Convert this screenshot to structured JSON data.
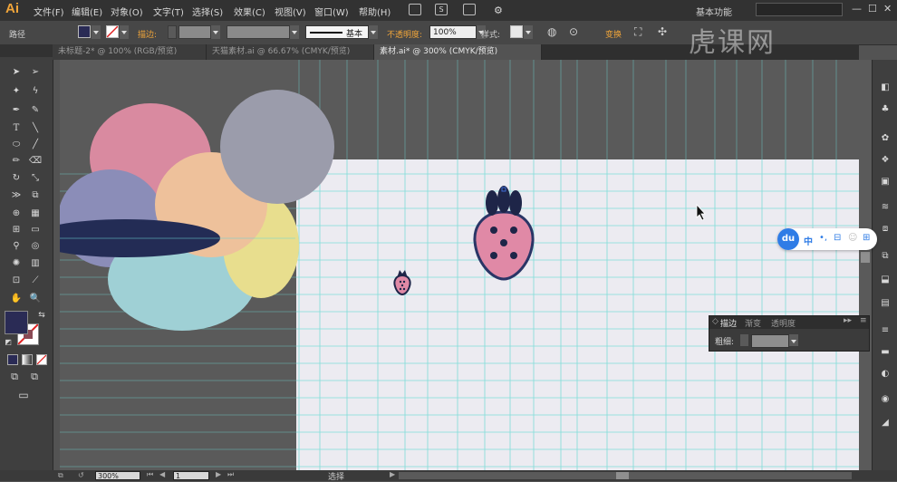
{
  "app": {
    "logo": "Ai"
  },
  "menu": [
    "文件(F)",
    "编辑(E)",
    "对象(O)",
    "文字(T)",
    "选择(S)",
    "效果(C)",
    "视图(V)",
    "窗口(W)",
    "帮助(H)"
  ],
  "menubar_icons": [
    "bridge-icon",
    "stock-icon",
    "arrange-icon",
    "sync-icon"
  ],
  "workspace": "基本功能",
  "window_controls": [
    "—",
    "☐",
    "✕"
  ],
  "control_bar": {
    "selection_type": "路径",
    "stroke_label": "描边:",
    "stroke_style": "基本",
    "opacity_label": "不透明度:",
    "opacity_value": "100%",
    "style_label": "样式:",
    "transform_label": "变换"
  },
  "tabs": [
    {
      "label": "未标题-2* @ 100% (RGB/预览)",
      "active": false
    },
    {
      "label": "天猫素材.ai @ 66.67% (CMYK/预览)",
      "active": false
    },
    {
      "label": "素材.ai* @ 300% (CMYK/预览)",
      "active": true
    }
  ],
  "tools": [
    "selection",
    "direct-selection",
    "magic-wand",
    "lasso",
    "pen",
    "curvature",
    "type",
    "line",
    "rectangle",
    "paintbrush",
    "pencil",
    "eraser",
    "rotate",
    "scale",
    "width",
    "free-transform",
    "shape-builder",
    "perspective",
    "mesh",
    "gradient",
    "eyedropper",
    "blend",
    "symbol-sprayer",
    "column-graph",
    "artboard",
    "slice",
    "hand",
    "zoom"
  ],
  "colors": {
    "fill": "#2a2b55",
    "pink": "#d98aa0",
    "periwinkle": "#8b8db8",
    "peach": "#eec19b",
    "yellow": "#e8de8e",
    "teal": "#9fd0d5",
    "gray": "#9b9cab",
    "navy": "#232c55",
    "guide": "#6cd5d2",
    "accent_orange": "#f0a53a"
  },
  "stroke_panel": {
    "tabs": [
      "描边",
      "渐变",
      "透明度"
    ],
    "weight_label": "粗细:"
  },
  "baidu_toolbar": {
    "logo": "du",
    "lang": "中",
    "items": [
      "dot-icon",
      "bag-icon",
      "person-icon",
      "grid-icon"
    ]
  },
  "status": {
    "zoom": "300%",
    "page": "1",
    "tool_name": "选择"
  },
  "watermark": "虎课网"
}
